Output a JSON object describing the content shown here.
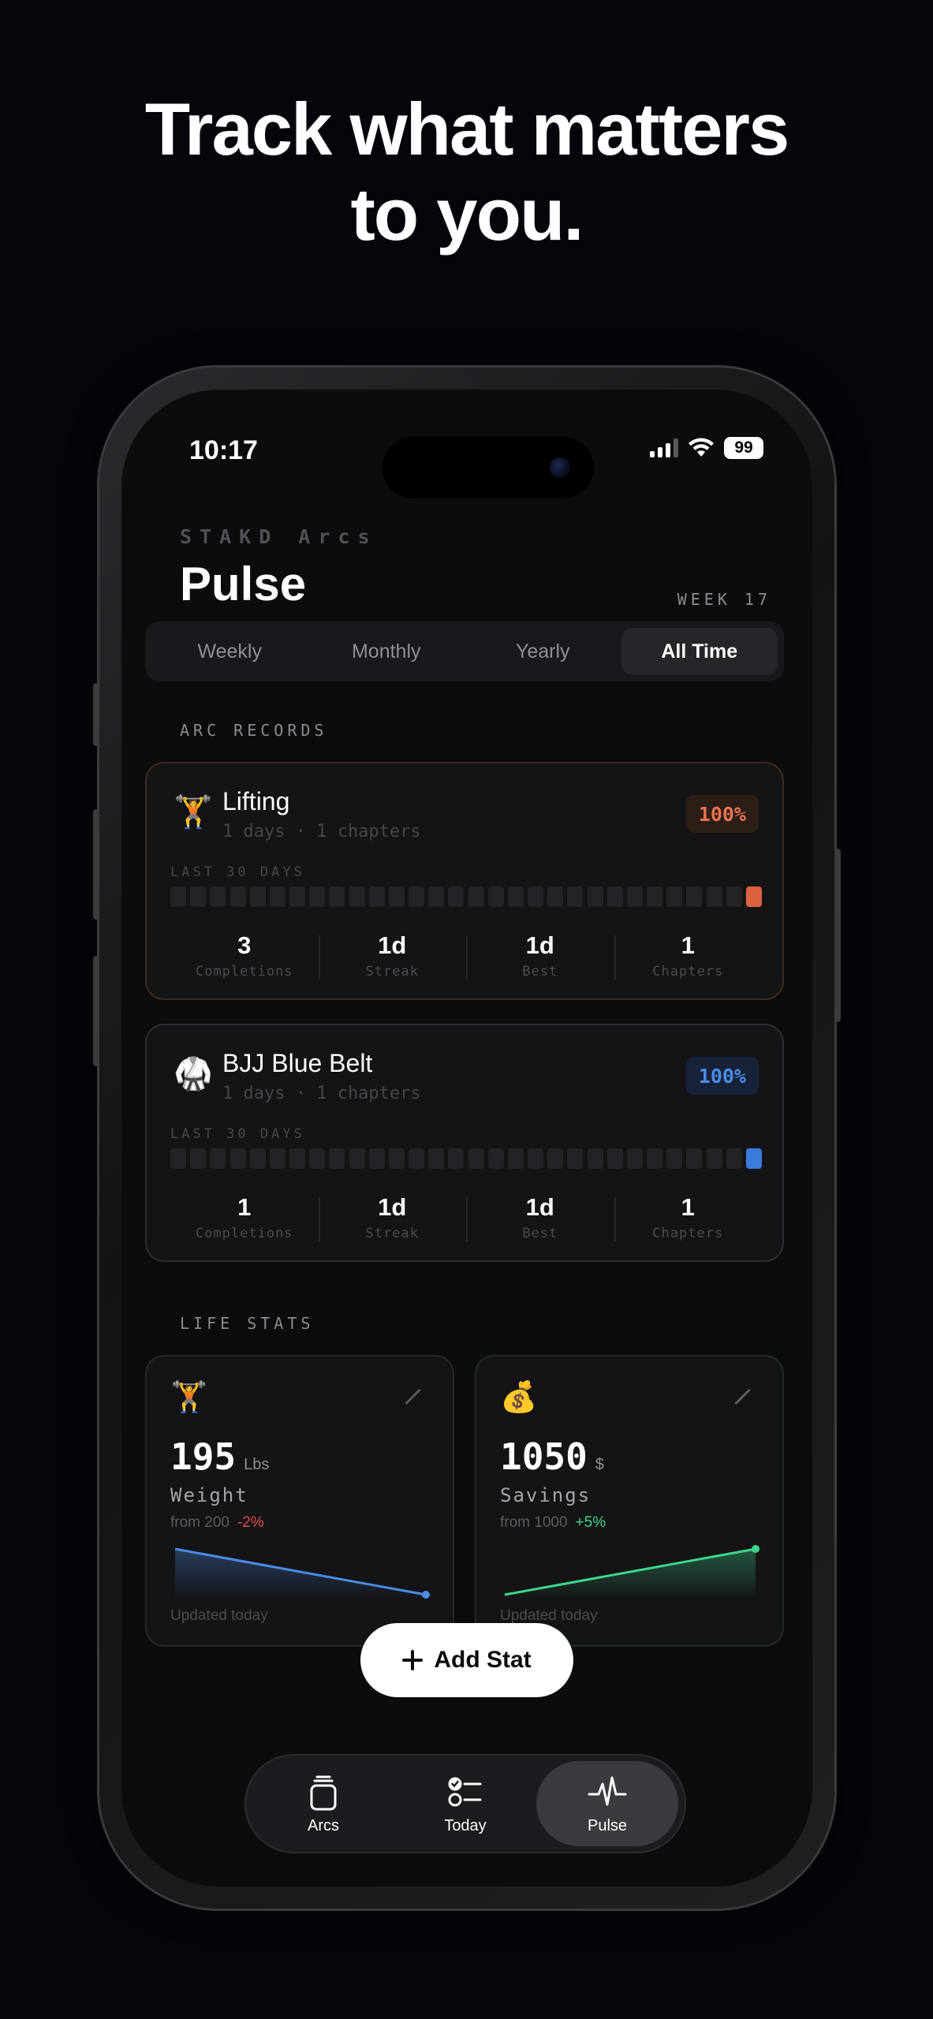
{
  "headline": {
    "line1": "Track what matters",
    "line2": "to you."
  },
  "status_bar": {
    "time": "10:17",
    "battery": "99"
  },
  "header": {
    "brand": "STAKD Arcs",
    "title": "Pulse",
    "week": "WEEK 17"
  },
  "segments": {
    "items": [
      "Weekly",
      "Monthly",
      "Yearly",
      "All Time"
    ],
    "selected": "All Time"
  },
  "arc_records": {
    "label": "ARC RECORDS",
    "last30_label": "LAST 30 DAYS",
    "cards": [
      {
        "emoji": "🏋️",
        "name": "Lifting",
        "subtitle": "1 days · 1 chapters",
        "percent": "100%",
        "accent": "#d9643f",
        "days_active": [
          30
        ],
        "stats": [
          {
            "value": "3",
            "label": "Completions"
          },
          {
            "value": "1d",
            "label": "Streak"
          },
          {
            "value": "1d",
            "label": "Best"
          },
          {
            "value": "1",
            "label": "Chapters"
          }
        ]
      },
      {
        "emoji": "🥋",
        "name": "BJJ Blue Belt",
        "subtitle": "1 days · 1 chapters",
        "percent": "100%",
        "accent": "#3b7bdb",
        "days_active": [
          30
        ],
        "stats": [
          {
            "value": "1",
            "label": "Completions"
          },
          {
            "value": "1d",
            "label": "Streak"
          },
          {
            "value": "1d",
            "label": "Best"
          },
          {
            "value": "1",
            "label": "Chapters"
          }
        ]
      }
    ]
  },
  "life_stats": {
    "label": "LIFE STATS",
    "cards": [
      {
        "emoji": "🏋️",
        "value": "195",
        "unit": "Lbs",
        "label": "Weight",
        "from": "from 200",
        "delta": "-2%",
        "trend_color": "#4b8ce5",
        "trend": [
          200,
          195
        ],
        "updated": "Updated today"
      },
      {
        "emoji": "💰",
        "value": "1050",
        "unit": "$",
        "label": "Savings",
        "from": "from 1000",
        "delta": "+5%",
        "trend_color": "#3dd68c",
        "trend": [
          1000,
          1050
        ],
        "updated": "Updated today"
      }
    ]
  },
  "add_stat": {
    "label": "Add Stat"
  },
  "tabbar": {
    "items": [
      {
        "label": "Arcs",
        "icon": "stack-icon"
      },
      {
        "label": "Today",
        "icon": "checklist-icon"
      },
      {
        "label": "Pulse",
        "icon": "pulse-icon"
      }
    ],
    "selected": "Pulse"
  }
}
